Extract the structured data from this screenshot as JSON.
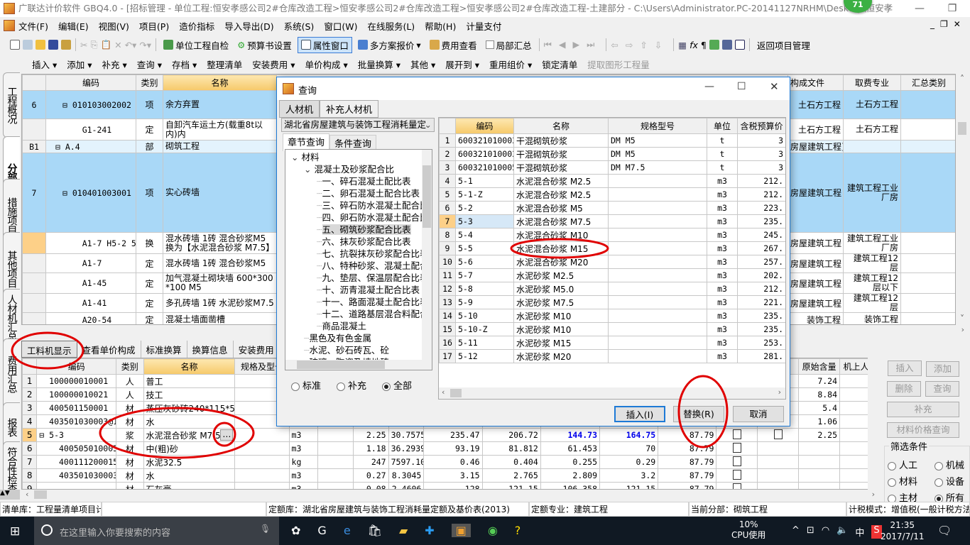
{
  "window": {
    "title": "广联达计价软件 GBQ4.0 - [招标管理 - 单位工程:恒安孝感公司2#仓库改造工程>恒安孝感公司2#仓库改造工程>恒安孝感公司2#仓库改造工程-土建部分 - C:\\Users\\Administrator.PC-20141127NRHM\\Desktop\\恒安孝",
    "badge": "71"
  },
  "menu": [
    "文件(F)",
    "编辑(E)",
    "视图(V)",
    "项目(P)",
    "造价指标",
    "导入导出(D)",
    "系统(S)",
    "窗口(W)",
    "在线服务(L)",
    "帮助(H)",
    "计量支付"
  ],
  "toolbar1": {
    "self_check": "单位工程自检",
    "budget_settings": "预算书设置",
    "property_window": "属性窗口",
    "multi_quote": "多方案报价",
    "fee_view": "费用查看",
    "partial_summary": "局部汇总",
    "return_project": "返回项目管理"
  },
  "toolbar2": [
    "插入",
    "添加",
    "补充",
    "查询",
    "存档",
    "整理清单",
    "安装费用",
    "单价构成",
    "批量换算",
    "其他",
    "展开到",
    "重用组价",
    "锁定清单",
    "提取图形工程量"
  ],
  "side_tabs": [
    "工程概况",
    "分部分项",
    "措施项目",
    "其他项目",
    "人材机汇总",
    "费用汇总",
    "报表",
    "符合性检查"
  ],
  "main_grid": {
    "headers": [
      "",
      "编码",
      "类别",
      "名称",
      "构成文件",
      "取费专业",
      "汇总类别"
    ],
    "rows": [
      {
        "no": "6",
        "code": "010103002002",
        "type": "项",
        "name": "余方弃置",
        "file": "土石方工程",
        "major": "土石方工程",
        "kind": "item"
      },
      {
        "no": "",
        "code": "G1-241",
        "type": "定",
        "name": "自卸汽车运土方(载重8t以内)内",
        "file": "土石方工程",
        "major": "土石方工程",
        "kind": "quota"
      },
      {
        "no": "B1",
        "code": "A.4",
        "type": "部",
        "name": "砌筑工程",
        "file": "房屋建筑工程]",
        "major": "",
        "kind": "part"
      },
      {
        "no": "7",
        "code": "010401003001",
        "type": "项",
        "name": "实心砖墙",
        "file": "房屋建筑工程",
        "major": "建筑工程工业厂房",
        "kind": "item"
      },
      {
        "no": "",
        "code": "A1-7 H5-2 5-3",
        "type": "换",
        "name": "混水砖墙 1砖 混合砂浆M5 换为【水泥混合砂浆 M7.5】",
        "file": "房屋建筑工程",
        "major": "建筑工程工业厂房",
        "kind": "current"
      },
      {
        "no": "",
        "code": "A1-7",
        "type": "定",
        "name": "混水砖墙 1砖 混合砂浆M5",
        "file": "房屋建筑工程",
        "major": "建筑工程12层",
        "kind": "quota"
      },
      {
        "no": "",
        "code": "A1-45",
        "type": "定",
        "name": "加气混凝土砌块墙 600*300*100 M5",
        "file": "房屋建筑工程",
        "major": "建筑工程12层以下",
        "kind": "quota"
      },
      {
        "no": "",
        "code": "A1-41",
        "type": "定",
        "name": "多孔砖墙 1砖 水泥砂浆M7.5",
        "file": "房屋建筑工程",
        "major": "建筑工程12层",
        "kind": "quota"
      },
      {
        "no": "",
        "code": "A20-54",
        "type": "定",
        "name": "混凝土墙面凿槽",
        "file": "装饰工程",
        "major": "装饰工程",
        "kind": "quota"
      }
    ]
  },
  "bottom_tabs": [
    "工料机显示",
    "查看单价构成",
    "标准换算",
    "换算信息",
    "安装费用"
  ],
  "bottom_grid": {
    "headers": [
      "",
      "编码",
      "类别",
      "名称",
      "规格及型号",
      "单位",
      "",
      "",
      "",
      "",
      "",
      "",
      "",
      "",
      "",
      "",
      "原始含量",
      "机上人工"
    ],
    "rows": [
      {
        "no": "1",
        "code": "100000010001",
        "type": "人",
        "name": "普工",
        "unit": "",
        "v": [
          "",
          "",
          "",
          "",
          "",
          "",
          "",
          ""
        ],
        "cb": [
          false,
          false
        ],
        "orig": "7.24"
      },
      {
        "no": "2",
        "code": "100000010021",
        "type": "人",
        "name": "技工",
        "unit": "",
        "v": [
          "",
          "",
          "",
          "",
          "",
          "",
          "",
          ""
        ],
        "cb": [
          false,
          false
        ],
        "orig": "8.84"
      },
      {
        "no": "3",
        "code": "400501150001",
        "type": "材",
        "name": "蒸压灰砂砖240*115*53",
        "unit": "",
        "v": [
          "",
          "",
          "",
          "",
          "",
          "",
          "",
          ""
        ],
        "cb": [
          false,
          false
        ],
        "orig": "5.4"
      },
      {
        "no": "4",
        "code": "403501030003@1",
        "type": "材",
        "name": "水",
        "unit": "",
        "v": [
          "",
          "",
          "",
          "",
          "",
          "",
          "",
          ""
        ],
        "cb": [
          false,
          false
        ],
        "orig": "1.06"
      },
      {
        "no": "5",
        "code": "5-3",
        "type": "浆",
        "name": "水泥混合砂浆 M7.5",
        "unit": "m3",
        "v": [
          "2.25",
          "30.7575",
          "235.47",
          "206.72",
          "144.73",
          "164.75",
          "87.79"
        ],
        "cb": [
          true,
          true
        ],
        "orig": "2.25",
        "current": true
      },
      {
        "no": "6",
        "code": "400505010005",
        "type": "材",
        "name": "中(粗)砂",
        "unit": "m3",
        "v": [
          "1.18",
          "36.2939",
          "93.19",
          "81.812",
          "61.453",
          "70",
          "87.79"
        ],
        "cb": [
          true,
          false
        ],
        "orig": ""
      },
      {
        "no": "7",
        "code": "400111200015",
        "type": "材",
        "name": "水泥32.5",
        "unit": "kg",
        "v": [
          "247",
          "7597.10",
          "0.46",
          "0.404",
          "0.255",
          "0.29",
          "87.79"
        ],
        "cb": [
          true,
          false
        ],
        "orig": ""
      },
      {
        "no": "8",
        "code": "403501030003",
        "type": "材",
        "name": "水",
        "unit": "m3",
        "v": [
          "0.27",
          "8.3045",
          "3.15",
          "2.765",
          "2.809",
          "3.2",
          "87.79"
        ],
        "cb": [
          true,
          false
        ],
        "orig": ""
      },
      {
        "no": "9",
        "code": "",
        "type": "材",
        "name": "石灰膏",
        "unit": "m3",
        "v": [
          "0.08",
          "2.4606",
          "128",
          "121.15",
          "106.358",
          "121.15",
          "87.79"
        ],
        "cb": [
          true,
          false
        ],
        "orig": ""
      }
    ]
  },
  "right_panel": {
    "insert": "插入",
    "add": "添加",
    "delete": "删除",
    "query": "查询",
    "supplement": "补充",
    "price_query": "材料价格查询",
    "filter_title": "筛选条件",
    "filters": [
      {
        "label": "人工",
        "on": false
      },
      {
        "label": "机械",
        "on": false
      },
      {
        "label": "材料",
        "on": false
      },
      {
        "label": "设备",
        "on": false
      },
      {
        "label": "主材",
        "on": false
      },
      {
        "label": "所有",
        "on": true
      }
    ]
  },
  "dialog": {
    "title": "查询",
    "tabs": [
      "人材机",
      "补充人材机"
    ],
    "library": "湖北省房屋建筑与装饰工程消耗量定",
    "query_tabs": [
      "章节查询",
      "条件查询"
    ],
    "tree": [
      {
        "label": "材料",
        "level": 0,
        "expanded": true
      },
      {
        "label": "混凝土及砂浆配合比",
        "level": 1,
        "expanded": true
      },
      {
        "label": "一、碎石混凝土配比表",
        "level": 2
      },
      {
        "label": "二、卵石混凝土配合比表",
        "level": 2
      },
      {
        "label": "三、碎石防水混凝土配合比表",
        "level": 2
      },
      {
        "label": "四、卵石防水混凝土配合比表",
        "level": 2
      },
      {
        "label": "五、砌筑砂浆配合比表",
        "level": 2,
        "selected": true
      },
      {
        "label": "六、抹灰砂浆配合比表",
        "level": 2
      },
      {
        "label": "七、抗裂抹灰砂浆配合比表",
        "level": 2
      },
      {
        "label": "八、特种砂浆、混凝土配合比表",
        "level": 2
      },
      {
        "label": "九、垫层、保温层配合比表",
        "level": 2
      },
      {
        "label": "十、沥青混凝土配合比表",
        "level": 2
      },
      {
        "label": "十一、路面混凝土配合比表",
        "level": 2
      },
      {
        "label": "十二、道路基层混合料配合比表",
        "level": 2
      },
      {
        "label": "商品混凝土",
        "level": 2
      },
      {
        "label": "黑色及有色金属",
        "level": 1
      },
      {
        "label": "水泥、砂石砖瓦、砼",
        "level": 1
      },
      {
        "label": "玻璃、陶瓷及墙地砖",
        "level": 1
      }
    ],
    "scope": [
      {
        "label": "标准",
        "on": false
      },
      {
        "label": "补充",
        "on": false
      },
      {
        "label": "全部",
        "on": true
      }
    ],
    "grid_headers": [
      "",
      "编码",
      "名称",
      "规格型号",
      "单位",
      "含税预算价"
    ],
    "grid_rows": [
      [
        "1",
        "600321010003",
        "干混砌筑砂浆",
        "DM M5",
        "t",
        "3"
      ],
      [
        "2",
        "600321010003",
        "干混砌筑砂浆",
        "DM M5",
        "t",
        "3"
      ],
      [
        "3",
        "600321010005",
        "干混砌筑砂浆",
        "DM M7.5",
        "t",
        "3"
      ],
      [
        "4",
        "5-1",
        "水泥混合砂浆 M2.5",
        "",
        "m3",
        "212."
      ],
      [
        "5",
        "5-1-Z",
        "水泥混合砂浆 M2.5",
        "",
        "m3",
        "212."
      ],
      [
        "6",
        "5-2",
        "水泥混合砂浆 M5",
        "",
        "m3",
        "223."
      ],
      [
        "7",
        "5-3",
        "水泥混合砂浆 M7.5",
        "",
        "m3",
        "235."
      ],
      [
        "8",
        "5-4",
        "水泥混合砂浆 M10",
        "",
        "m3",
        "245."
      ],
      [
        "9",
        "5-5",
        "水泥混合砂浆 M15",
        "",
        "m3",
        "267."
      ],
      [
        "10",
        "5-6",
        "水泥混合砂浆 M20",
        "",
        "m3",
        "257."
      ],
      [
        "11",
        "5-7",
        "水泥砂浆 M2.5",
        "",
        "m3",
        "202."
      ],
      [
        "12",
        "5-8",
        "水泥砂浆 M5.0",
        "",
        "m3",
        "212."
      ],
      [
        "13",
        "5-9",
        "水泥砂浆 M7.5",
        "",
        "m3",
        "221."
      ],
      [
        "14",
        "5-10",
        "水泥砂浆 M10",
        "",
        "m3",
        "235."
      ],
      [
        "15",
        "5-10-Z",
        "水泥砂浆 M10",
        "",
        "m3",
        "235."
      ],
      [
        "16",
        "5-11",
        "水泥砂浆 M15",
        "",
        "m3",
        "253."
      ],
      [
        "17",
        "5-12",
        "水泥砂浆 M20",
        "",
        "m3",
        "281."
      ]
    ],
    "selected_row": 7,
    "insert": "插入(I)",
    "replace": "替换(R)",
    "cancel": "取消"
  },
  "status": {
    "bill_lib": "清单库：工程量清单项目计量规范(2013-湖北)",
    "quota_lib": "定额库：湖北省房屋建筑与装饰工程消耗量定额及基价表(2013)",
    "quota_major": "定额专业：建筑工程",
    "current_part": "当前分部：砌筑工程",
    "tax_mode": "计税模式：增值税(一般计税方法)"
  },
  "taskbar": {
    "search_placeholder": "在这里输入你要搜索的内容",
    "cpu": "10%",
    "cpu_label": "CPU使用",
    "ime": "中",
    "time": "21:35",
    "date": "2017/7/11"
  },
  "colors": {
    "selected_row": "#a9d8f7",
    "header_highlight": "#f6c96a",
    "annotation": "#e00000",
    "blue_value": "#0000ee"
  }
}
